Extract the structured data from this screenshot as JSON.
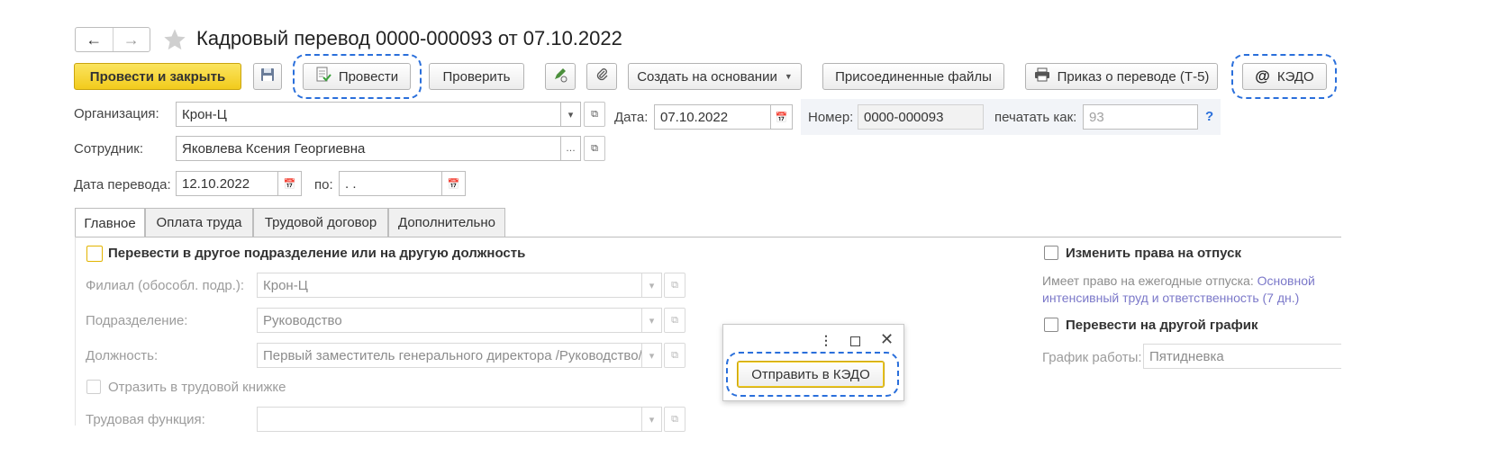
{
  "window": {
    "title": "Кадровый перевод 0000-000093 от 07.10.2022",
    "back_icon": "←",
    "forward_icon": "→"
  },
  "toolbar": {
    "post_and_close": "Провести и закрыть",
    "post": "Провести",
    "check": "Проверить",
    "create_based_on": "Создать на основании",
    "attached_files": "Присоединенные файлы",
    "print_order": "Приказ о переводе (Т-5)",
    "kedo": "КЭДО"
  },
  "header": {
    "organization_label": "Организация:",
    "organization_value": "Крон-Ц",
    "date_label": "Дата:",
    "date_value": "07.10.2022",
    "number_label": "Номер:",
    "number_value": "0000-000093",
    "print_as_label": "печатать как:",
    "print_as_value": "93",
    "help": "?",
    "employee_label": "Сотрудник:",
    "employee_value": "Яковлева Ксения Георгиевна",
    "transfer_date_label": "Дата перевода:",
    "transfer_date_value": "12.10.2022",
    "to_label": "по:",
    "to_value": " .  ."
  },
  "tabs": [
    {
      "label": "Главное",
      "active": true
    },
    {
      "label": "Оплата труда",
      "active": false
    },
    {
      "label": "Трудовой договор",
      "active": false
    },
    {
      "label": "Дополнительно",
      "active": false
    }
  ],
  "main": {
    "transfer_checkbox_label": "Перевести в другое подразделение или на другую должность",
    "branch_label": "Филиал (обособл. подр.):",
    "branch_value": "Крон-Ц",
    "department_label": "Подразделение:",
    "department_value": "Руководство",
    "position_label": "Должность:",
    "position_value": "Первый заместитель генерального директора /Руководство/",
    "workbook_label": "Отразить в трудовой книжке",
    "labor_function_label": "Трудовая функция:",
    "labor_function_value": ""
  },
  "right": {
    "leave_rights_label": "Изменить права на отпуск",
    "leave_text_prefix": "Имеет право на ежегодные отпуска: ",
    "leave_text_link1": "Основной",
    "leave_text_link2": "интенсивный труд и ответственность (7 дн.)",
    "schedule_label": "Перевести на другой график",
    "work_schedule_label": "График работы:",
    "work_schedule_value": "Пятидневка"
  },
  "popup": {
    "send_button": "Отправить в КЭДО"
  },
  "colors": {
    "accent_yellow": "#f2cb1c",
    "highlight_dash": "#2a6fdb",
    "link": "#7b78c9"
  }
}
